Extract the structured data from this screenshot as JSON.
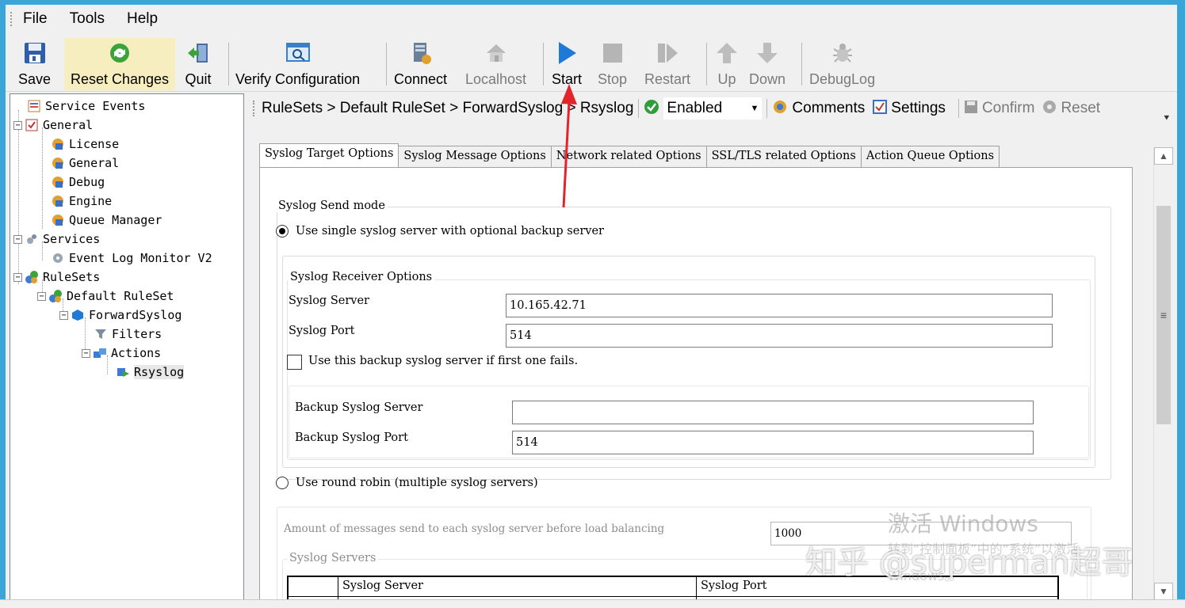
{
  "menu": {
    "items": [
      "File",
      "Tools",
      "Help"
    ]
  },
  "toolbar": {
    "save": "Save",
    "reset_changes": "Reset Changes",
    "quit": "Quit",
    "verify_configuration": "Verify Configuration",
    "connect": "Connect",
    "localhost": "Localhost",
    "start": "Start",
    "stop": "Stop",
    "restart": "Restart",
    "up": "Up",
    "down": "Down",
    "debuglog": "DebugLog"
  },
  "tree": {
    "service_events": "Service Events",
    "general": "General",
    "license": "License",
    "general_child": "General",
    "debug": "Debug",
    "engine": "Engine",
    "queue_manager": "Queue Manager",
    "services": "Services",
    "event_log_monitor": "Event Log Monitor V2",
    "rulesets": "RuleSets",
    "default_ruleset": "Default RuleSet",
    "forwardsyslog": "ForwardSyslog",
    "filters": "Filters",
    "actions": "Actions",
    "rsyslog": "Rsyslog"
  },
  "breadcrumb": {
    "path": "RuleSets > Default RuleSet > ForwardSyslog > Rsyslog",
    "enabled": "Enabled",
    "comments": "Comments",
    "settings": "Settings",
    "confirm": "Confirm",
    "reset": "Reset"
  },
  "tabs": [
    "Syslog Target Options",
    "Syslog Message Options",
    "Network related Options",
    "SSL/TLS related Options",
    "Action Queue Options"
  ],
  "form": {
    "send_mode_title": "Syslog Send mode",
    "single_server_label": "Use single syslog server with optional backup server",
    "receiver_options_title": "Syslog Receiver Options",
    "syslog_server_label": "Syslog Server",
    "syslog_server_value": "10.165.42.71",
    "syslog_port_label": "Syslog Port",
    "syslog_port_value": "514",
    "use_backup_label": "Use this backup syslog server if first one fails.",
    "backup_server_label": "Backup Syslog Server",
    "backup_server_value": "",
    "backup_port_label": "Backup Syslog Port",
    "backup_port_value": "514",
    "round_robin_label": "Use round robin (multiple syslog servers)",
    "amount_label": "Amount of messages send to each syslog server before load balancing",
    "amount_value": "1000",
    "syslog_servers_title": "Syslog Servers",
    "table_headers": [
      "Syslog Server",
      "Syslog Port"
    ]
  },
  "watermark": {
    "activate_windows": "激活 Windows",
    "activate_sub": "转到“控制面板”中的“系统”以激活",
    "activate_sub2": "Windows。",
    "zhihu": "知乎 @superman超哥"
  },
  "colors": {
    "desktop": "#3aa6d8",
    "window": "#f0f0f0",
    "arrow": "#e3242b",
    "start_icon": "#1e7ad6"
  }
}
